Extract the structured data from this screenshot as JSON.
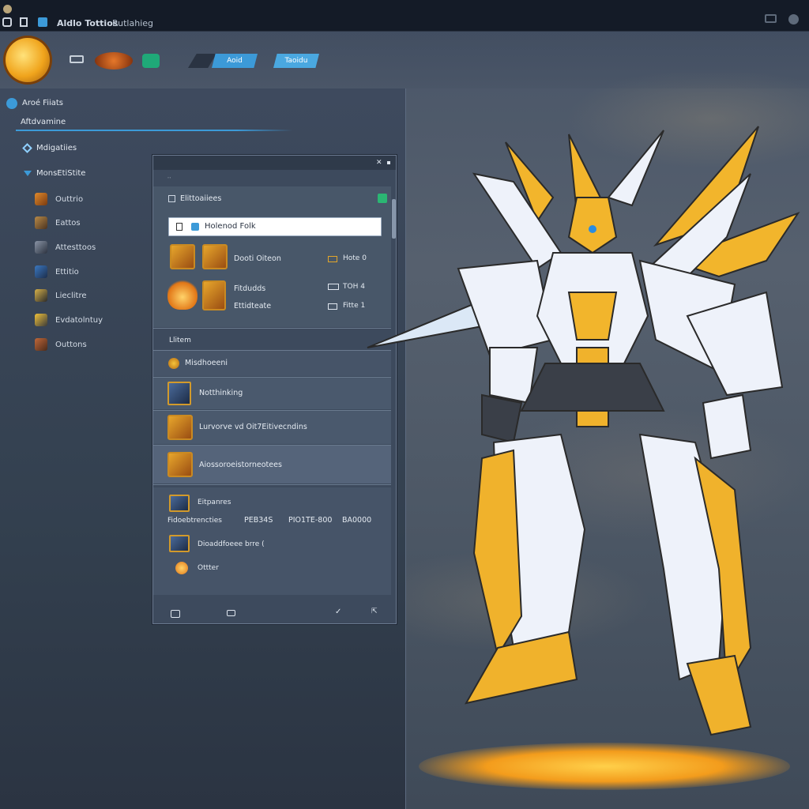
{
  "titlebar": {
    "app_name": "Aldlo Tottios",
    "menu_label": "Rutlahieg"
  },
  "topbar": {
    "tab_1": "Aoid",
    "tab_2": "Taoidu"
  },
  "left_panel": {
    "header": "Aroé Fiiats",
    "subheader": "Aftdvamine",
    "section_1": "Mdigatiies",
    "section_2": "MonsEtiStite",
    "nav_items": [
      "Outtrio",
      "Eattos",
      "Attesttoos",
      "Ettitio",
      "Lieclitre",
      "Evdatolntuy",
      "Outtons"
    ]
  },
  "dialog": {
    "title": "Elittoaiiees",
    "search_value": "Holenod Folk",
    "items": [
      {
        "name": "Dooti Oiteon",
        "meta": "Hote 0"
      },
      {
        "name": "Fitdudds",
        "meta": "TOH 4"
      },
      {
        "name": "Ettidteate",
        "meta": "Fitte 1"
      }
    ],
    "section_label": "Llitem",
    "list": [
      "Misdhoeeni",
      "Notthinking",
      "Lurvorve vd Oit7Eitivecndins",
      "Aiossoroeistorneotees"
    ],
    "footer": {
      "row1_label": "Eitpanres",
      "row2_label": "Fidoebtrencties",
      "col1": "PEB34S",
      "col2": "PIO1TE-800",
      "col3": "BA0000",
      "row3_label": "Dioaddfoeee brre (",
      "row4_label": "Ottter"
    }
  },
  "colors": {
    "accent_blue": "#3c9ad8",
    "gold": "#e2a52a",
    "panel": "#3e4a5e"
  }
}
